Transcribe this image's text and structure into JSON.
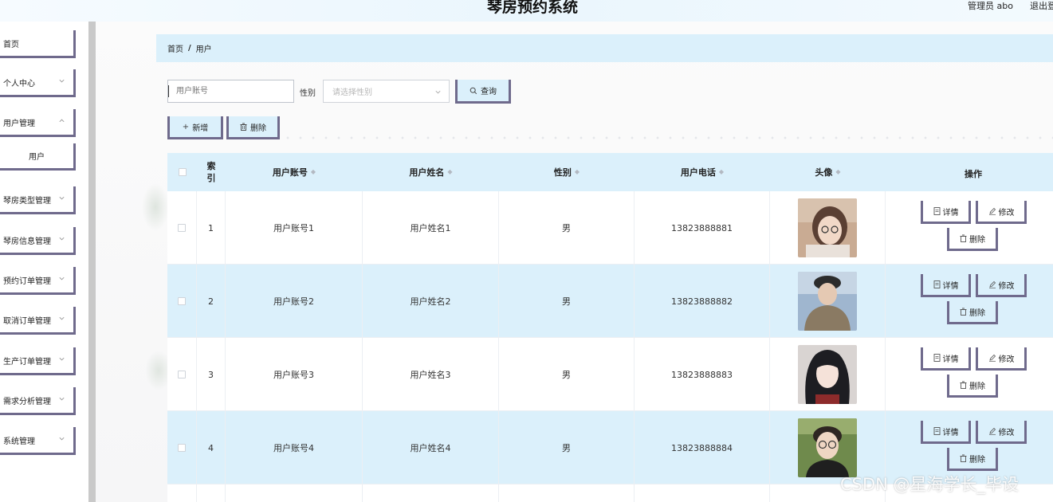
{
  "header": {
    "title": "琴房预约系统",
    "admin_text": "管理员 abo",
    "logout_text": "退出登"
  },
  "sidebar": {
    "items": [
      {
        "label": "首页",
        "has_chevron": false
      },
      {
        "label": "个人中心",
        "has_chevron": true
      },
      {
        "label": "用户管理",
        "has_chevron": true
      },
      {
        "label": "琴房类型管理",
        "has_chevron": true
      },
      {
        "label": "琴房信息管理",
        "has_chevron": true
      },
      {
        "label": "预约订单管理",
        "has_chevron": true
      },
      {
        "label": "取消订单管理",
        "has_chevron": true
      },
      {
        "label": "生产订单管理",
        "has_chevron": true
      },
      {
        "label": "需求分析管理",
        "has_chevron": true
      },
      {
        "label": "系统管理",
        "has_chevron": true
      }
    ],
    "subitem": "用户"
  },
  "breadcrumb": {
    "home": "首页",
    "separator": "/",
    "current": "用户"
  },
  "search": {
    "account_placeholder": "用户账号",
    "gender_label": "性别",
    "gender_placeholder": "请选择性别",
    "search_button": "查询"
  },
  "actions": {
    "add_button": "新增",
    "delete_button": "删除"
  },
  "table": {
    "headers": {
      "index": "索引",
      "account": "用户账号",
      "name": "用户姓名",
      "gender": "性别",
      "phone": "用户电话",
      "avatar": "头像",
      "operation": "操作"
    },
    "rows": [
      {
        "index": "1",
        "account": "用户账号1",
        "name": "用户姓名1",
        "gender": "男",
        "phone": "13823888881",
        "avatar": "avatar-1"
      },
      {
        "index": "2",
        "account": "用户账号2",
        "name": "用户姓名2",
        "gender": "男",
        "phone": "13823888882",
        "avatar": "avatar-2"
      },
      {
        "index": "3",
        "account": "用户账号3",
        "name": "用户姓名3",
        "gender": "男",
        "phone": "13823888883",
        "avatar": "avatar-3"
      },
      {
        "index": "4",
        "account": "用户账号4",
        "name": "用户姓名4",
        "gender": "男",
        "phone": "13823888884",
        "avatar": "avatar-4"
      }
    ],
    "row_actions": {
      "detail": "详情",
      "edit": "修改",
      "delete": "删除"
    }
  },
  "watermark": "CSDN @星海学长_毕设",
  "colors": {
    "accent_light": "#dbf0fb",
    "border_dark": "#6f6a8c"
  },
  "icons": [
    "chevron-down-icon",
    "search-icon",
    "plus-icon",
    "trash-icon",
    "document-icon",
    "edit-icon"
  ]
}
